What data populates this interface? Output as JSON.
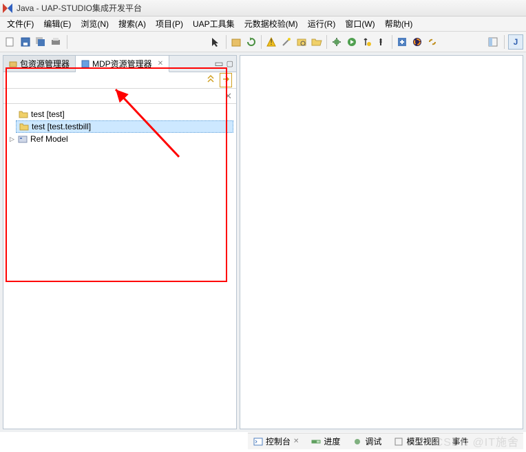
{
  "title": "Java - UAP-STUDIO集成开发平台",
  "menus": {
    "file": "文件(F)",
    "edit": "编辑(E)",
    "browse": "浏览(N)",
    "search": "搜索(A)",
    "project": "项目(P)",
    "uap": "UAP工具集",
    "metadata": "元数据校验(M)",
    "run": "运行(R)",
    "window": "窗口(W)",
    "help": "帮助(H)"
  },
  "tabs": {
    "pkg": "包资源管理器",
    "mdp": "MDP资源管理器"
  },
  "tree": {
    "item1": "test [test]",
    "item2": "test [test.testbill]",
    "item3": "Ref Model"
  },
  "bottom": {
    "console": "控制台",
    "progress": "进度",
    "debug": "调试",
    "modelview": "模型视图",
    "events": "事件"
  },
  "watermark": "CSDN @IT施舍",
  "colors": {
    "highlight": "#ff0000",
    "selection": "#cde8ff"
  }
}
